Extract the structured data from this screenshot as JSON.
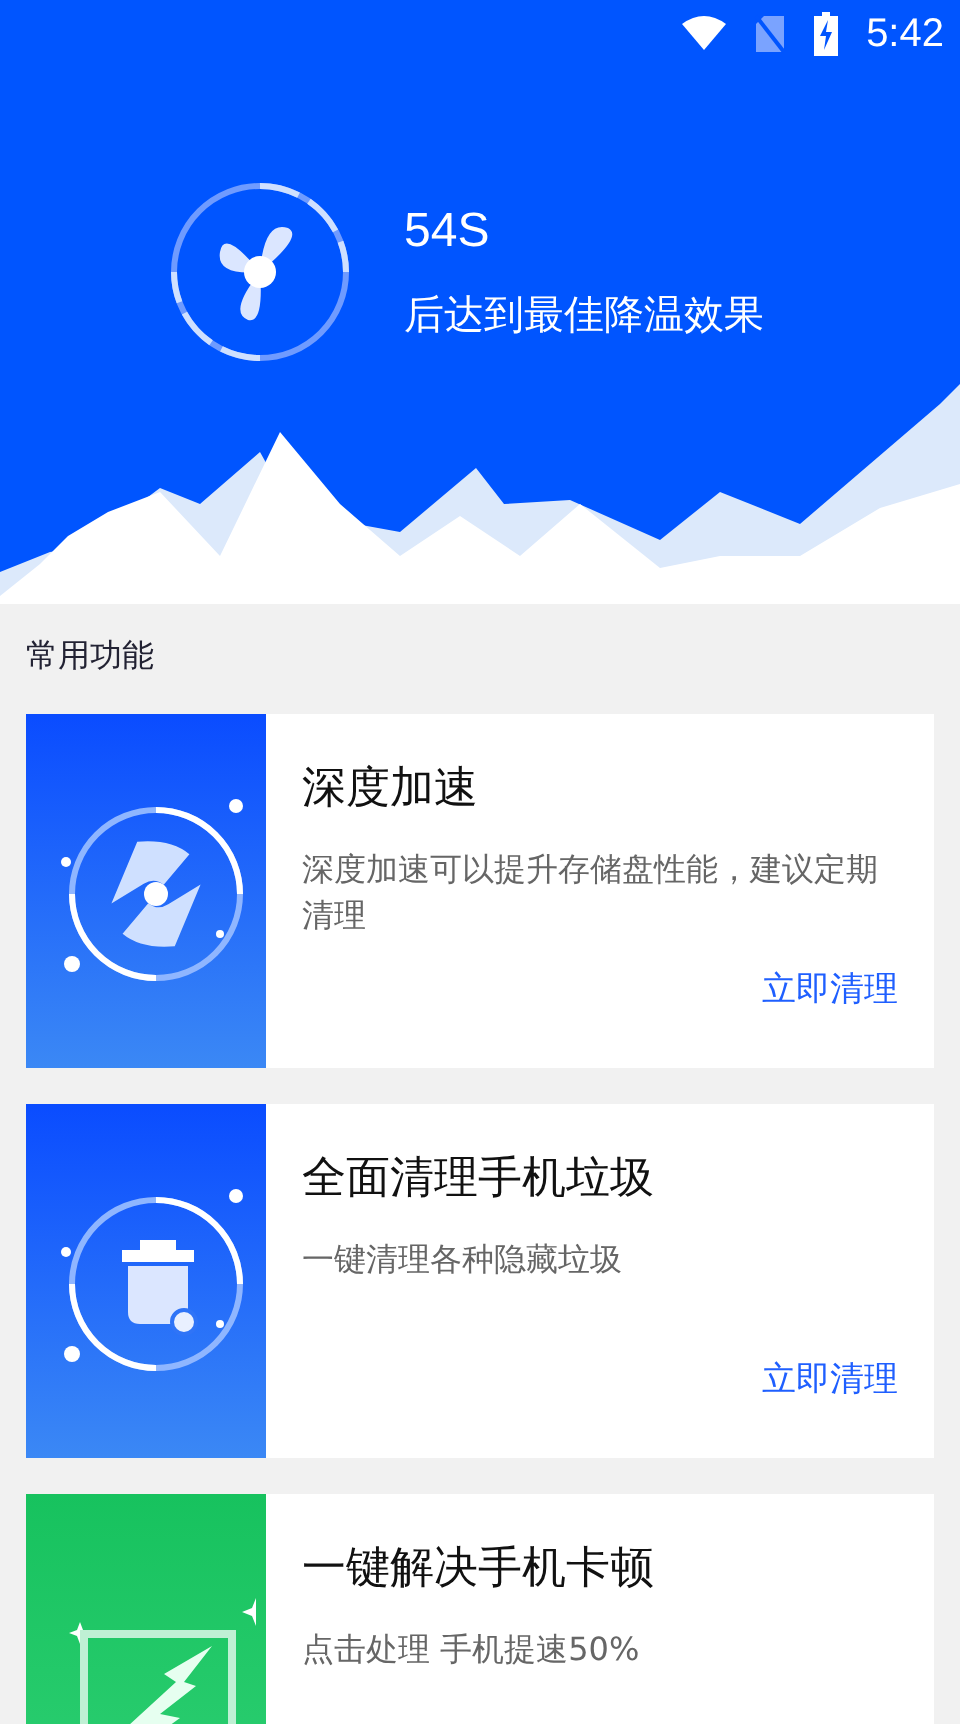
{
  "status_bar": {
    "time": "5:42"
  },
  "header": {
    "countdown": "54S",
    "caption": "后达到最佳降温效果"
  },
  "section_title": "常用功能",
  "cards": [
    {
      "kind": "disc",
      "title": "深度加速",
      "description": "深度加速可以提升存储盘性能，建议定期清理",
      "action": "立即清理"
    },
    {
      "kind": "trash",
      "title": "全面清理手机垃圾",
      "description": "一键清理各种隐藏垃圾",
      "action": "立即清理"
    },
    {
      "kind": "bolt",
      "title": "一键解决手机卡顿",
      "description": "点击处理 手机提速50%"
    }
  ]
}
